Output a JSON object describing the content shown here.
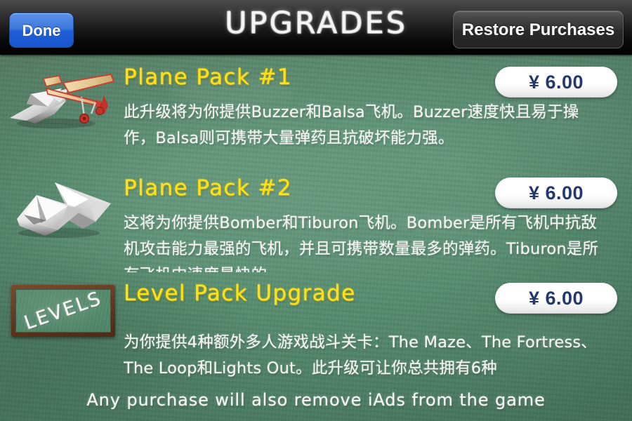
{
  "navbar": {
    "done_label": "Done",
    "title": "UPGRADES",
    "restore_label": "Restore Purchases"
  },
  "products": [
    {
      "title": "Plane Pack #1",
      "price": "¥ 6.00",
      "description": "此升级将为你提供Buzzer和Balsa飞机。Buzzer速度快且易于操作，Balsa则可携带大量弹药且抗破坏能力强。",
      "icon": "paper-plane-and-balsa-plane-icon"
    },
    {
      "title": "Plane Pack #2",
      "price": "¥ 6.00",
      "description": "这将为你提供Bomber和Tiburon飞机。Bomber是所有飞机中抗敌机攻击能力最强的飞机，并且可携带数量最多的弹药。Tiburon是所有飞机中速度最快的",
      "icon": "two-paper-planes-icon"
    },
    {
      "title": "Level Pack Upgrade",
      "price": "¥ 6.00",
      "description": "为你提供4种额外多人游戏战斗关卡：The Maze、The Fortress、The Loop和Lights Out。此升级可让你总共拥有6种",
      "icon": "levels-chalkboard-icon",
      "icon_text": "LEVELS"
    }
  ],
  "footer": {
    "note": "Any purchase will also remove iAds from the game"
  },
  "colors": {
    "board_green": "#5e9376",
    "title_yellow": "#ffe014",
    "price_navy": "#23386e",
    "done_blue": "#1f5fd6",
    "navbar_black": "#000000",
    "chalk_white": "#f2f5f2",
    "wood_frame": "#63381f"
  }
}
